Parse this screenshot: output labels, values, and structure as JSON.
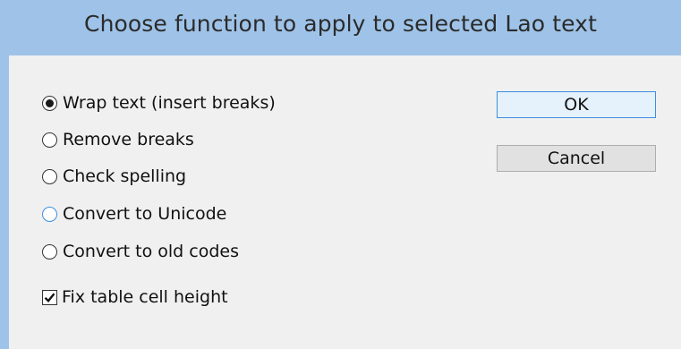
{
  "dialog": {
    "title": "Choose function to apply to selected Lao text"
  },
  "options": [
    {
      "label": "Wrap text (insert breaks)",
      "selected": true
    },
    {
      "label": "Remove breaks",
      "selected": false
    },
    {
      "label": "Check spelling",
      "selected": false
    },
    {
      "label": "Convert to Unicode",
      "selected": false,
      "focused": true
    },
    {
      "label": "Convert to old codes",
      "selected": false
    }
  ],
  "fix_height": {
    "label": "Fix table cell height",
    "checked": true
  },
  "buttons": {
    "ok": "OK",
    "cancel": "Cancel"
  },
  "colors": {
    "titlebar": "#9fc3e8",
    "client": "#f0f0f0",
    "focus_accent": "#3c8fe0"
  }
}
